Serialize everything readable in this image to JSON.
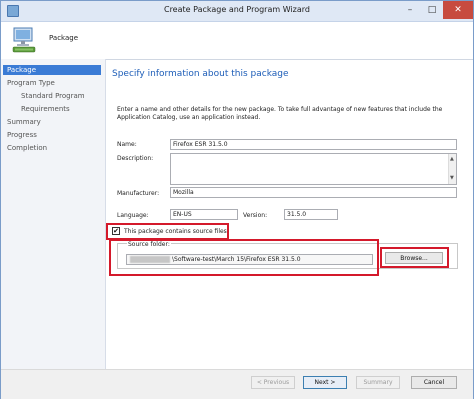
{
  "window": {
    "title": "Create Package and Program Wizard",
    "close": "✕",
    "minimize": "–",
    "maximize": "□"
  },
  "header": {
    "title": "Package",
    "icon": "computer-icon"
  },
  "nav": {
    "items": [
      {
        "label": "Package",
        "active": true,
        "sub": false
      },
      {
        "label": "Program Type",
        "active": false,
        "sub": false
      },
      {
        "label": "Standard Program",
        "active": false,
        "sub": true
      },
      {
        "label": "Requirements",
        "active": false,
        "sub": true
      },
      {
        "label": "Summary",
        "active": false,
        "sub": false
      },
      {
        "label": "Progress",
        "active": false,
        "sub": false
      },
      {
        "label": "Completion",
        "active": false,
        "sub": false
      }
    ]
  },
  "main": {
    "heading": "Specify information about this package",
    "intro": "Enter a name and other details for the new package. To take full advantage of new features that include the Application Catalog, use an application instead.",
    "name_label": "Name:",
    "name_value": "Firefox ESR 31.5.0",
    "description_label": "Description:",
    "description_value": "",
    "manufacturer_label": "Manufacturer:",
    "manufacturer_value": "Mozilla",
    "language_label": "Language:",
    "language_value": "EN-US",
    "version_label": "Version:",
    "version_value": "31.5.0",
    "source_files_checkbox_label": "This package contains source files",
    "source_files_checked": true,
    "source_folder_label": "Source folder:",
    "source_folder_value": "\\Software-test\\March 15\\Firefox ESR 31.5.0",
    "browse_label": "Browse..."
  },
  "footer": {
    "previous_label": "< Previous",
    "next_label": "Next >",
    "summary_label": "Summary",
    "cancel_label": "Cancel"
  },
  "colors": {
    "accent": "#3a7bd5",
    "heading": "#1e5eb8",
    "highlight": "#d4192b"
  }
}
